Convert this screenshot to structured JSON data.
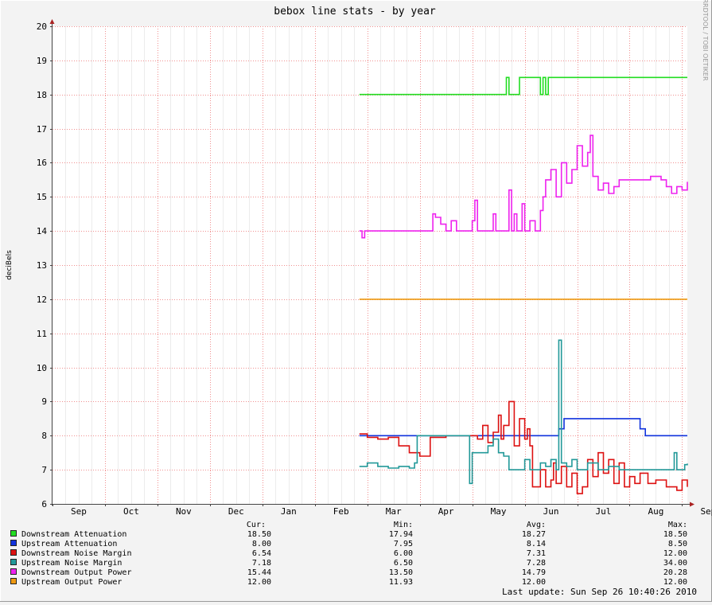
{
  "chart_data": {
    "type": "line",
    "title": "bebox line stats - by year",
    "ylabel": "deciBels",
    "xlabel": "",
    "ylim": [
      6,
      20
    ],
    "yticks": [
      6,
      7,
      8,
      9,
      10,
      11,
      12,
      13,
      14,
      15,
      16,
      17,
      18,
      19,
      20
    ],
    "x_categories": [
      "Sep",
      "Oct",
      "Nov",
      "Dec",
      "Jan",
      "Feb",
      "Mar",
      "Apr",
      "May",
      "Jun",
      "Jul",
      "Aug",
      "Sep"
    ],
    "x_domain": [
      0,
      12.1
    ],
    "grid": true,
    "watermark": "RRDTOOL / TOBI OETIKER",
    "legend_headers": {
      "cur": "Cur:",
      "min": "Min:",
      "avg": "Avg:",
      "max": "Max:"
    },
    "last_update": "Last update: Sun Sep 26 10:40:26 2010",
    "series": [
      {
        "name": "Downstream Attenuation",
        "color": "#22dd22",
        "cur": "18.50",
        "min": "17.94",
        "avg": "18.27",
        "max": "18.50",
        "points": [
          [
            5.85,
            18.0
          ],
          [
            8.65,
            18.0
          ],
          [
            8.65,
            18.5
          ],
          [
            8.7,
            18.5
          ],
          [
            8.7,
            18.0
          ],
          [
            8.9,
            18.0
          ],
          [
            8.9,
            18.5
          ],
          [
            9.3,
            18.5
          ],
          [
            9.3,
            18.0
          ],
          [
            9.35,
            18.0
          ],
          [
            9.35,
            18.5
          ],
          [
            9.4,
            18.5
          ],
          [
            9.4,
            18.0
          ],
          [
            9.45,
            18.0
          ],
          [
            9.45,
            18.5
          ],
          [
            12.1,
            18.5
          ]
        ]
      },
      {
        "name": "Upstream Attenuation",
        "color": "#1133dd",
        "cur": "8.00",
        "min": "7.95",
        "avg": "8.14",
        "max": "8.50",
        "points": [
          [
            5.85,
            8.0
          ],
          [
            9.65,
            8.0
          ],
          [
            9.65,
            8.2
          ],
          [
            9.75,
            8.2
          ],
          [
            9.75,
            8.5
          ],
          [
            11.2,
            8.5
          ],
          [
            11.2,
            8.2
          ],
          [
            11.3,
            8.2
          ],
          [
            11.3,
            8.0
          ],
          [
            12.1,
            8.0
          ]
        ]
      },
      {
        "name": "Downstream Noise Margin",
        "color": "#dd1111",
        "cur": "6.54",
        "min": "6.00",
        "avg": "7.31",
        "max": "12.00",
        "points": [
          [
            5.85,
            8.05
          ],
          [
            6.0,
            7.95
          ],
          [
            6.2,
            7.9
          ],
          [
            6.4,
            7.95
          ],
          [
            6.6,
            7.7
          ],
          [
            6.8,
            7.5
          ],
          [
            7.0,
            7.4
          ],
          [
            7.2,
            7.95
          ],
          [
            7.5,
            8.0
          ],
          [
            8.0,
            8.0
          ],
          [
            8.1,
            7.9
          ],
          [
            8.2,
            8.3
          ],
          [
            8.3,
            7.8
          ],
          [
            8.4,
            8.1
          ],
          [
            8.5,
            8.6
          ],
          [
            8.55,
            7.9
          ],
          [
            8.6,
            8.3
          ],
          [
            8.7,
            9.0
          ],
          [
            8.8,
            7.7
          ],
          [
            8.9,
            8.5
          ],
          [
            9.0,
            7.9
          ],
          [
            9.05,
            8.2
          ],
          [
            9.1,
            7.7
          ],
          [
            9.15,
            6.5
          ],
          [
            9.3,
            7.0
          ],
          [
            9.4,
            6.5
          ],
          [
            9.5,
            6.7
          ],
          [
            9.55,
            7.2
          ],
          [
            9.6,
            6.6
          ],
          [
            9.7,
            7.1
          ],
          [
            9.8,
            6.5
          ],
          [
            9.9,
            6.9
          ],
          [
            10.0,
            6.3
          ],
          [
            10.1,
            6.5
          ],
          [
            10.2,
            7.3
          ],
          [
            10.3,
            6.8
          ],
          [
            10.4,
            7.5
          ],
          [
            10.5,
            6.9
          ],
          [
            10.6,
            7.3
          ],
          [
            10.7,
            6.6
          ],
          [
            10.8,
            7.2
          ],
          [
            10.9,
            6.5
          ],
          [
            11.0,
            6.8
          ],
          [
            11.1,
            6.6
          ],
          [
            11.2,
            6.9
          ],
          [
            11.35,
            6.6
          ],
          [
            11.5,
            6.7
          ],
          [
            11.7,
            6.5
          ],
          [
            11.9,
            6.4
          ],
          [
            12.0,
            6.7
          ],
          [
            12.1,
            6.5
          ]
        ]
      },
      {
        "name": "Upstream Noise Margin",
        "color": "#229999",
        "cur": "7.18",
        "min": "6.50",
        "avg": "7.28",
        "max": "34.00",
        "points": [
          [
            5.85,
            7.1
          ],
          [
            6.0,
            7.2
          ],
          [
            6.2,
            7.1
          ],
          [
            6.4,
            7.05
          ],
          [
            6.6,
            7.1
          ],
          [
            6.8,
            7.05
          ],
          [
            6.9,
            7.2
          ],
          [
            6.95,
            8.0
          ],
          [
            7.5,
            8.0
          ],
          [
            7.8,
            8.0
          ],
          [
            7.95,
            6.6
          ],
          [
            8.0,
            7.5
          ],
          [
            8.2,
            7.5
          ],
          [
            8.3,
            7.7
          ],
          [
            8.4,
            7.9
          ],
          [
            8.5,
            7.5
          ],
          [
            8.6,
            7.4
          ],
          [
            8.7,
            7.0
          ],
          [
            8.9,
            7.0
          ],
          [
            9.0,
            7.3
          ],
          [
            9.1,
            7.0
          ],
          [
            9.3,
            7.2
          ],
          [
            9.4,
            7.1
          ],
          [
            9.5,
            7.3
          ],
          [
            9.6,
            7.0
          ],
          [
            9.65,
            10.8
          ],
          [
            9.7,
            7.2
          ],
          [
            9.8,
            7.1
          ],
          [
            9.9,
            7.3
          ],
          [
            10.0,
            7.0
          ],
          [
            10.2,
            7.2
          ],
          [
            10.4,
            7.0
          ],
          [
            10.6,
            7.1
          ],
          [
            10.8,
            7.0
          ],
          [
            11.0,
            7.0
          ],
          [
            11.2,
            7.0
          ],
          [
            11.4,
            7.0
          ],
          [
            11.6,
            7.0
          ],
          [
            11.8,
            7.0
          ],
          [
            11.85,
            7.5
          ],
          [
            11.9,
            7.0
          ],
          [
            12.0,
            7.0
          ],
          [
            12.05,
            7.15
          ],
          [
            12.1,
            7.18
          ]
        ]
      },
      {
        "name": "Downstream Output Power",
        "color": "#ee22ee",
        "cur": "15.44",
        "min": "13.50",
        "avg": "14.79",
        "max": "20.28",
        "points": [
          [
            5.85,
            14.0
          ],
          [
            5.9,
            13.8
          ],
          [
            5.95,
            14.0
          ],
          [
            7.2,
            14.0
          ],
          [
            7.25,
            14.5
          ],
          [
            7.3,
            14.4
          ],
          [
            7.4,
            14.2
          ],
          [
            7.5,
            14.0
          ],
          [
            7.6,
            14.3
          ],
          [
            7.7,
            14.0
          ],
          [
            7.8,
            14.0
          ],
          [
            8.0,
            14.3
          ],
          [
            8.05,
            14.9
          ],
          [
            8.1,
            14.0
          ],
          [
            8.4,
            14.5
          ],
          [
            8.45,
            14.0
          ],
          [
            8.6,
            14.0
          ],
          [
            8.7,
            15.2
          ],
          [
            8.75,
            14.0
          ],
          [
            8.8,
            14.5
          ],
          [
            8.85,
            14.0
          ],
          [
            8.95,
            14.8
          ],
          [
            9.0,
            14.0
          ],
          [
            9.1,
            14.3
          ],
          [
            9.2,
            14.0
          ],
          [
            9.3,
            14.6
          ],
          [
            9.35,
            15.0
          ],
          [
            9.4,
            15.5
          ],
          [
            9.5,
            15.8
          ],
          [
            9.6,
            15.0
          ],
          [
            9.7,
            16.0
          ],
          [
            9.8,
            15.4
          ],
          [
            9.9,
            15.8
          ],
          [
            10.0,
            16.5
          ],
          [
            10.1,
            15.9
          ],
          [
            10.2,
            16.3
          ],
          [
            10.25,
            16.8
          ],
          [
            10.3,
            15.6
          ],
          [
            10.4,
            15.2
          ],
          [
            10.5,
            15.4
          ],
          [
            10.6,
            15.1
          ],
          [
            10.7,
            15.3
          ],
          [
            10.8,
            15.5
          ],
          [
            11.0,
            15.5
          ],
          [
            11.2,
            15.5
          ],
          [
            11.4,
            15.6
          ],
          [
            11.6,
            15.5
          ],
          [
            11.7,
            15.3
          ],
          [
            11.8,
            15.1
          ],
          [
            11.9,
            15.3
          ],
          [
            12.0,
            15.2
          ],
          [
            12.1,
            15.44
          ]
        ]
      },
      {
        "name": "Upstream Output Power",
        "color": "#ee9911",
        "cur": "12.00",
        "min": "11.93",
        "avg": "12.00",
        "max": "12.00",
        "points": [
          [
            5.85,
            12.0
          ],
          [
            12.1,
            12.0
          ]
        ]
      }
    ]
  }
}
